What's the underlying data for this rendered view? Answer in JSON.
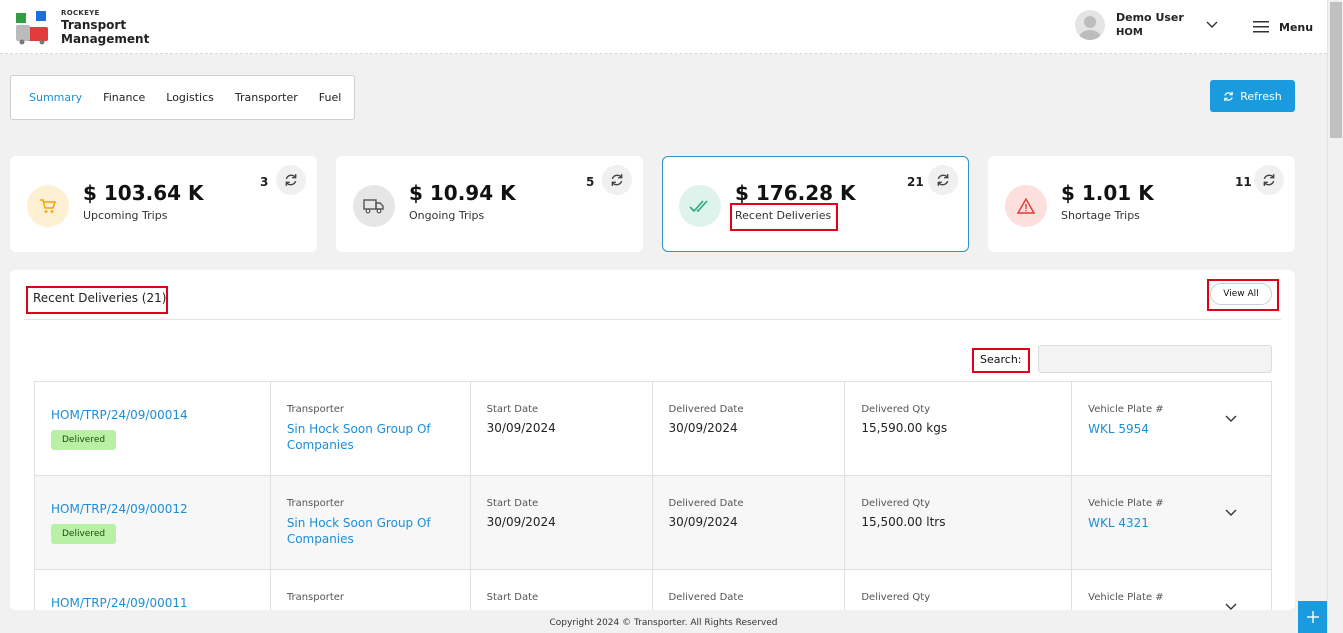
{
  "header": {
    "brand_small": "ROCKEYE",
    "brand_line1": "Transport",
    "brand_line2": "Management",
    "user_name": "Demo User",
    "user_role": "HOM",
    "menu_label": "Menu"
  },
  "tabs": [
    {
      "label": "Summary",
      "active": true
    },
    {
      "label": "Finance",
      "active": false
    },
    {
      "label": "Logistics",
      "active": false
    },
    {
      "label": "Transporter",
      "active": false
    },
    {
      "label": "Fuel",
      "active": false
    }
  ],
  "refresh_label": "Refresh",
  "cards": [
    {
      "amount": "$ 103.64 K",
      "label": "Upcoming Trips",
      "count": "3",
      "icon": "cart-icon",
      "icon_bg": "#fdf0d2",
      "icon_color": "#f0a500"
    },
    {
      "amount": "$ 10.94 K",
      "label": "Ongoing Trips",
      "count": "5",
      "icon": "truck-icon",
      "icon_bg": "#e6e6e6",
      "icon_color": "#555555"
    },
    {
      "amount": "$ 176.28 K",
      "label": "Recent Deliveries",
      "count": "21",
      "icon": "double-check-icon",
      "icon_bg": "#dff3ec",
      "icon_color": "#2aa87a"
    },
    {
      "amount": "$ 1.01 K",
      "label": "Shortage Trips",
      "count": "11",
      "icon": "warning-icon",
      "icon_bg": "#fde0de",
      "icon_color": "#e03a2e"
    }
  ],
  "panel": {
    "title": "Recent Deliveries (21)",
    "view_all": "View All",
    "search_label": "Search:",
    "search_value": ""
  },
  "columns": {
    "transporter": "Transporter",
    "start_date": "Start Date",
    "delivered_date": "Delivered Date",
    "delivered_qty": "Delivered Qty",
    "vehicle_plate": "Vehicle Plate #"
  },
  "rows": [
    {
      "trip": "HOM/TRP/24/09/00014",
      "status": "Delivered",
      "transporter": "Sin Hock Soon Group Of Companies",
      "start_date": "30/09/2024",
      "delivered_date": "30/09/2024",
      "delivered_qty": "15,590.00 kgs",
      "vehicle_plate": "WKL 5954"
    },
    {
      "trip": "HOM/TRP/24/09/00012",
      "status": "Delivered",
      "transporter": "Sin Hock Soon Group Of Companies",
      "start_date": "30/09/2024",
      "delivered_date": "30/09/2024",
      "delivered_qty": "15,500.00 ltrs",
      "vehicle_plate": "WKL 4321"
    },
    {
      "trip": "HOM/TRP/24/09/00011",
      "status": "",
      "transporter": "",
      "start_date": "",
      "delivered_date": "",
      "delivered_qty": "",
      "vehicle_plate": ""
    }
  ],
  "footer": "Copyright 2024 © Transporter. All Rights Reserved",
  "colors": {
    "accent": "#1a9be0",
    "link": "#1a8fd8",
    "highlight": "#e0001a"
  }
}
